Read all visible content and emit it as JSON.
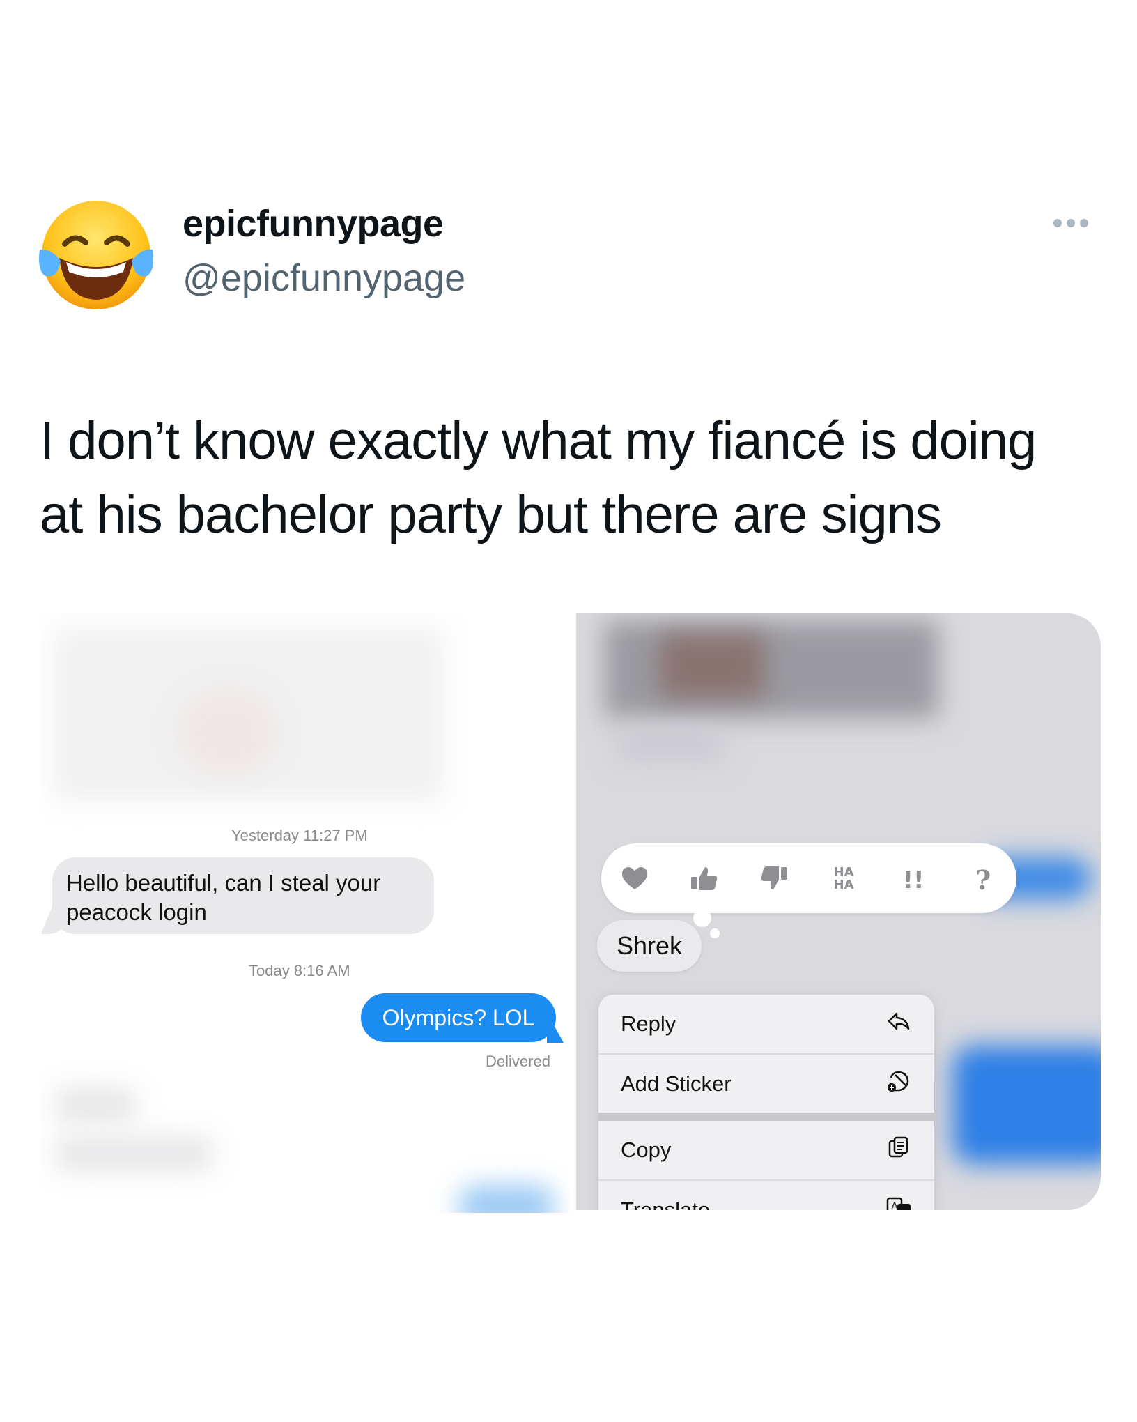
{
  "post": {
    "display_name": "epicfunnypage",
    "handle": "@epicfunnypage",
    "avatar_icon": "face-with-tears-of-joy-emoji",
    "text_line_1": "I don’t know exactly what my fiancé is doing",
    "text_line_2": "at his bachelor party but there are signs"
  },
  "left_chat": {
    "timestamp_1": "Yesterday 11:27 PM",
    "incoming_message_line_1": "Hello beautiful, can I steal your",
    "incoming_message_line_2": "peacock login",
    "timestamp_2": "Today 8:16 AM",
    "outgoing_message": "Olympics? LOL",
    "status": "Delivered",
    "incoming_bubble_color": "#e9e9eb",
    "outgoing_bubble_color": "#1a8cf2"
  },
  "right_chat": {
    "tapbacks": [
      "heart-icon",
      "thumbs-up-icon",
      "thumbs-down-icon",
      "haha-icon",
      "exclamation-icon",
      "question-icon"
    ],
    "tapback_haha_text": "HA HA",
    "tapback_exclaim_text": "!!",
    "tapback_question_text": "?",
    "selected_message": "Shrek",
    "menu": [
      {
        "label": "Reply",
        "icon": "reply-arrow-icon"
      },
      {
        "label": "Add Sticker",
        "icon": "add-sticker-icon"
      },
      {
        "label": "Copy",
        "icon": "copy-icon"
      },
      {
        "label": "Translate",
        "icon": "translate-icon"
      }
    ]
  }
}
